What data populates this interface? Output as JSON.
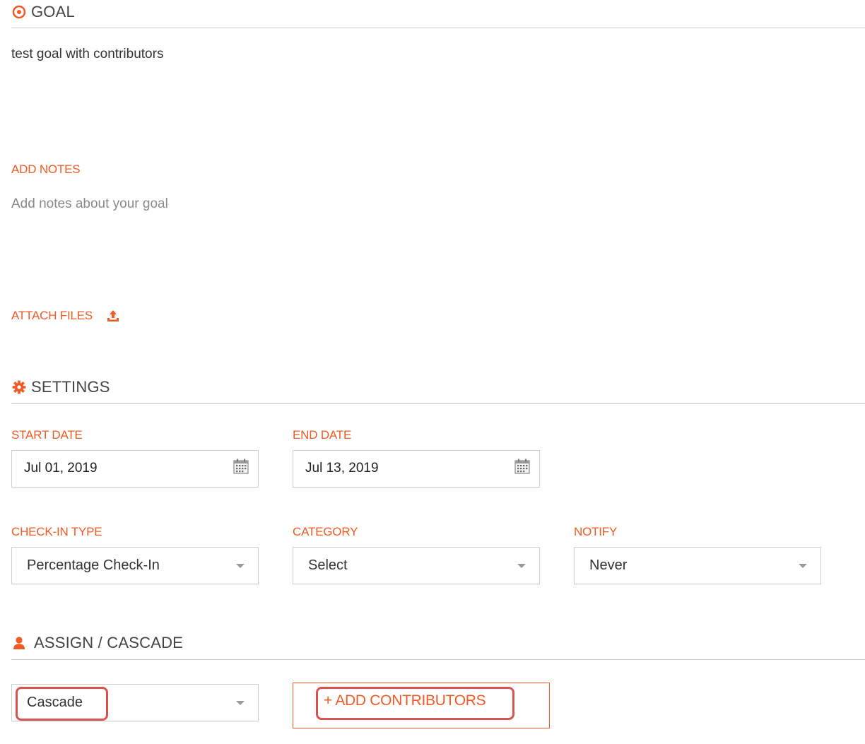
{
  "goal_section": {
    "title": "GOAL",
    "icon": "target-icon",
    "goal_text": "test goal with contributors"
  },
  "notes": {
    "label": "ADD NOTES",
    "placeholder": "Add notes about your goal"
  },
  "attach": {
    "label": "ATTACH FILES",
    "icon": "upload-icon"
  },
  "settings_section": {
    "title": "SETTINGS",
    "icon": "gear-icon",
    "start_date": {
      "label": "START DATE",
      "value": "Jul 01, 2019"
    },
    "end_date": {
      "label": "END DATE",
      "value": "Jul 13, 2019"
    },
    "checkin_type": {
      "label": "CHECK-IN TYPE",
      "value": "Percentage Check-In"
    },
    "category": {
      "label": "CATEGORY",
      "value": "Select"
    },
    "notify": {
      "label": "NOTIFY",
      "value": "Never"
    }
  },
  "assign_section": {
    "title": "ASSIGN / CASCADE",
    "icon": "user-icon",
    "mode": {
      "value": "Cascade"
    },
    "add_contributors_label": "+ ADD CONTRIBUTORS"
  },
  "colors": {
    "accent": "#f15a24",
    "highlight": "#d9534f",
    "rule": "#c8c8c8",
    "field_border": "#cfcfcf"
  }
}
